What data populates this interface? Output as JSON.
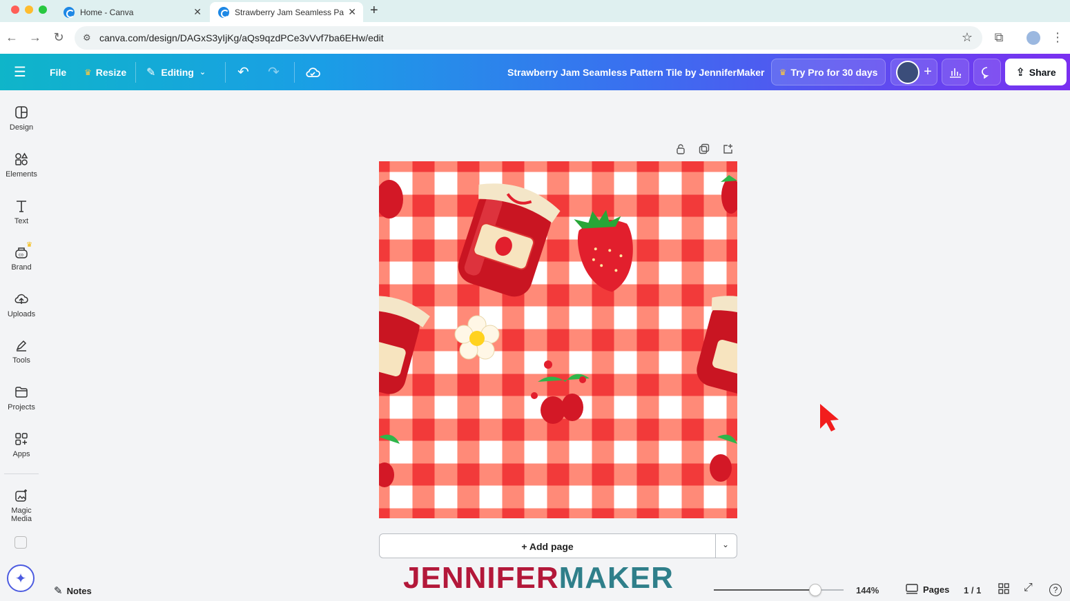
{
  "browser": {
    "tabs": [
      {
        "title": "Home - Canva"
      },
      {
        "title": "Strawberry Jam Seamless Pa"
      }
    ],
    "url": "canva.com/design/DAGxS3yIjKg/aQs9qzdPCe3vVvf7ba6EHw/edit"
  },
  "toolbar": {
    "file": "File",
    "resize": "Resize",
    "editing": "Editing",
    "title": "Strawberry Jam Seamless Pattern Tile by JenniferMaker",
    "try_pro": "Try Pro for 30 days",
    "share": "Share"
  },
  "sidebar": {
    "items": [
      {
        "label": "Design",
        "icon": "design-icon"
      },
      {
        "label": "Elements",
        "icon": "elements-icon"
      },
      {
        "label": "Text",
        "icon": "text-icon"
      },
      {
        "label": "Brand",
        "icon": "brand-icon"
      },
      {
        "label": "Uploads",
        "icon": "uploads-icon"
      },
      {
        "label": "Tools",
        "icon": "tools-icon"
      },
      {
        "label": "Projects",
        "icon": "projects-icon"
      },
      {
        "label": "Apps",
        "icon": "apps-icon"
      },
      {
        "label": "Magic Media",
        "icon": "magic-media-icon"
      }
    ]
  },
  "canvas": {
    "add_page": "+ Add page",
    "colors": {
      "dark_red": "#f23a3a",
      "light_red": "#ff8a78",
      "white": "#ffffff"
    }
  },
  "footer": {
    "notes": "Notes",
    "zoom": "144%",
    "pages_label": "Pages",
    "page_count": "1 / 1",
    "zoom_level": 0.78
  },
  "watermark": {
    "part1": "JENNIFER",
    "part2": "MAKER"
  }
}
